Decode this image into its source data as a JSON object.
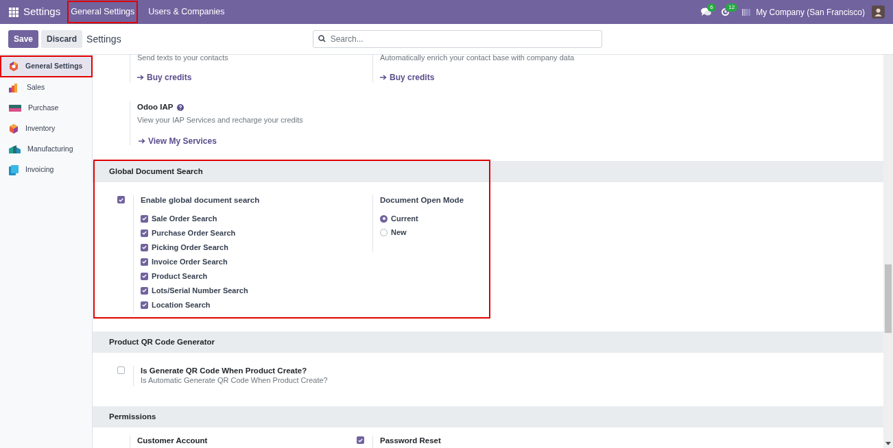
{
  "top_bar": {
    "app_title": "Settings",
    "menu": [
      {
        "label": "General Settings",
        "highlighted": true
      },
      {
        "label": "Users & Companies",
        "highlighted": false
      }
    ],
    "messages_count": "6",
    "activities_count": "12",
    "company": "My Company (San Francisco)"
  },
  "control_panel": {
    "buttons": [
      {
        "label": "Save",
        "kind": "primary"
      },
      {
        "label": "Discard",
        "kind": "secondary"
      }
    ],
    "breadcrumb": "Settings",
    "search": {
      "placeholder": "Search..."
    }
  },
  "sidebar": {
    "items": [
      {
        "label": "General Settings",
        "kind": "general",
        "selected": true,
        "highlighted": true
      },
      {
        "label": "Sales",
        "kind": "sales",
        "selected": false,
        "highlighted": false
      },
      {
        "label": "Purchase",
        "kind": "purchase",
        "selected": false,
        "highlighted": false
      },
      {
        "label": "Inventory",
        "kind": "inventory",
        "selected": false,
        "highlighted": false
      },
      {
        "label": "Manufacturing",
        "kind": "manufacturing",
        "selected": false,
        "highlighted": false
      },
      {
        "label": "Invoicing",
        "kind": "invoicing",
        "selected": false,
        "highlighted": false
      }
    ]
  },
  "partial_section": {
    "settings": [
      {
        "description": "Send texts to your contacts",
        "link": "Buy credits"
      },
      {
        "description": "Automatically enrich your contact base with company data",
        "link": "Buy credits"
      }
    ],
    "iap": {
      "title": "Odoo IAP",
      "description": "View your IAP Services and recharge your credits",
      "link": "View My Services"
    }
  },
  "global_document_search": {
    "title": "Global Document Search",
    "highlighted": true,
    "enable": {
      "label": "Enable global document search",
      "checked": true
    },
    "options": [
      {
        "label": "Sale Order Search",
        "checked": true
      },
      {
        "label": "Purchase Order Search",
        "checked": true
      },
      {
        "label": "Picking Order Search",
        "checked": true
      },
      {
        "label": "Invoice Order Search",
        "checked": true
      },
      {
        "label": "Product Search",
        "checked": true
      },
      {
        "label": "Lots/Serial Number Search",
        "checked": true
      },
      {
        "label": "Location Search",
        "checked": true
      }
    ],
    "open_mode": {
      "title": "Document Open Mode",
      "choices": [
        {
          "label": "Current",
          "selected": true
        },
        {
          "label": "New",
          "selected": false
        }
      ]
    }
  },
  "qr_section": {
    "title": "Product QR Code Generator",
    "setting": {
      "label": "Is Generate QR Code When Product Create?",
      "description": "Is Automatic Generate QR Code When Product Create?",
      "checked": false
    }
  },
  "permissions": {
    "title": "Permissions",
    "settings": [
      {
        "label": "Customer Account",
        "kind": "plain"
      },
      {
        "label": "Password Reset",
        "kind": "checkbox",
        "checked": true
      }
    ]
  }
}
